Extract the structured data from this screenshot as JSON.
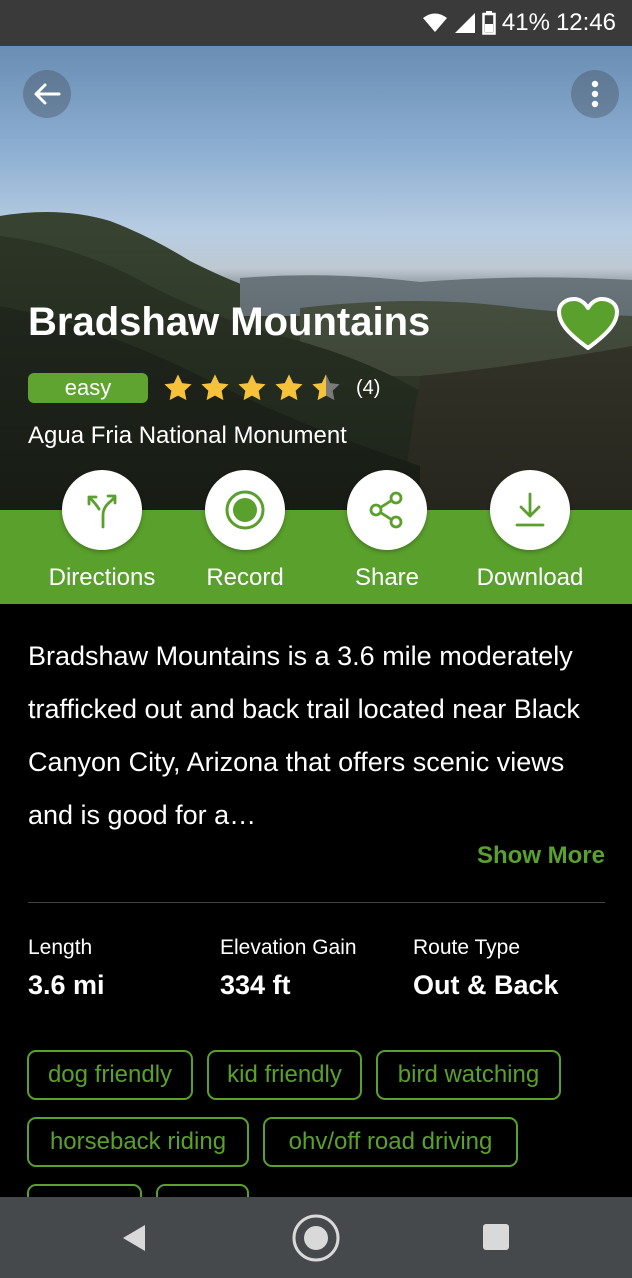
{
  "status_bar": {
    "battery": "41%",
    "time": "12:46",
    "icons": [
      "wifi-icon",
      "cell-signal-icon",
      "battery-icon"
    ]
  },
  "header": {
    "back_icon": "arrow-left-icon",
    "menu_icon": "more-vertical-icon"
  },
  "trail": {
    "name": "Bradshaw Mountains",
    "difficulty": "easy",
    "rating": 4.5,
    "rating_max": 5,
    "review_count": "(4)",
    "park": "Agua Fria National Monument",
    "favorited": true
  },
  "actions": [
    {
      "label": "Directions",
      "icon": "directions-icon"
    },
    {
      "label": "Record",
      "icon": "record-icon"
    },
    {
      "label": "Share",
      "icon": "share-icon"
    },
    {
      "label": "Download",
      "icon": "download-icon"
    }
  ],
  "description": {
    "text": "Bradshaw Mountains is a 3.6 mile moderately trafficked out and back trail located near Black Canyon City, Arizona that offers scenic views and is good for a…",
    "show_more": "Show More"
  },
  "stats": [
    {
      "label": "Length",
      "value": "3.6 mi"
    },
    {
      "label": "Elevation Gain",
      "value": "334 ft"
    },
    {
      "label": "Route Type",
      "value": "Out & Back"
    }
  ],
  "tags": [
    "dog friendly",
    "kid friendly",
    "bird watching",
    "horseback riding",
    "ohv/off road driving"
  ],
  "colors": {
    "accent": "#5aa02c",
    "difficulty_badge": "#5fa431",
    "star": "#f6c23a",
    "heart": "#5aa02c"
  },
  "nav_bar": {
    "icons": [
      "back-triangle-icon",
      "home-circle-icon",
      "recents-square-icon"
    ]
  }
}
